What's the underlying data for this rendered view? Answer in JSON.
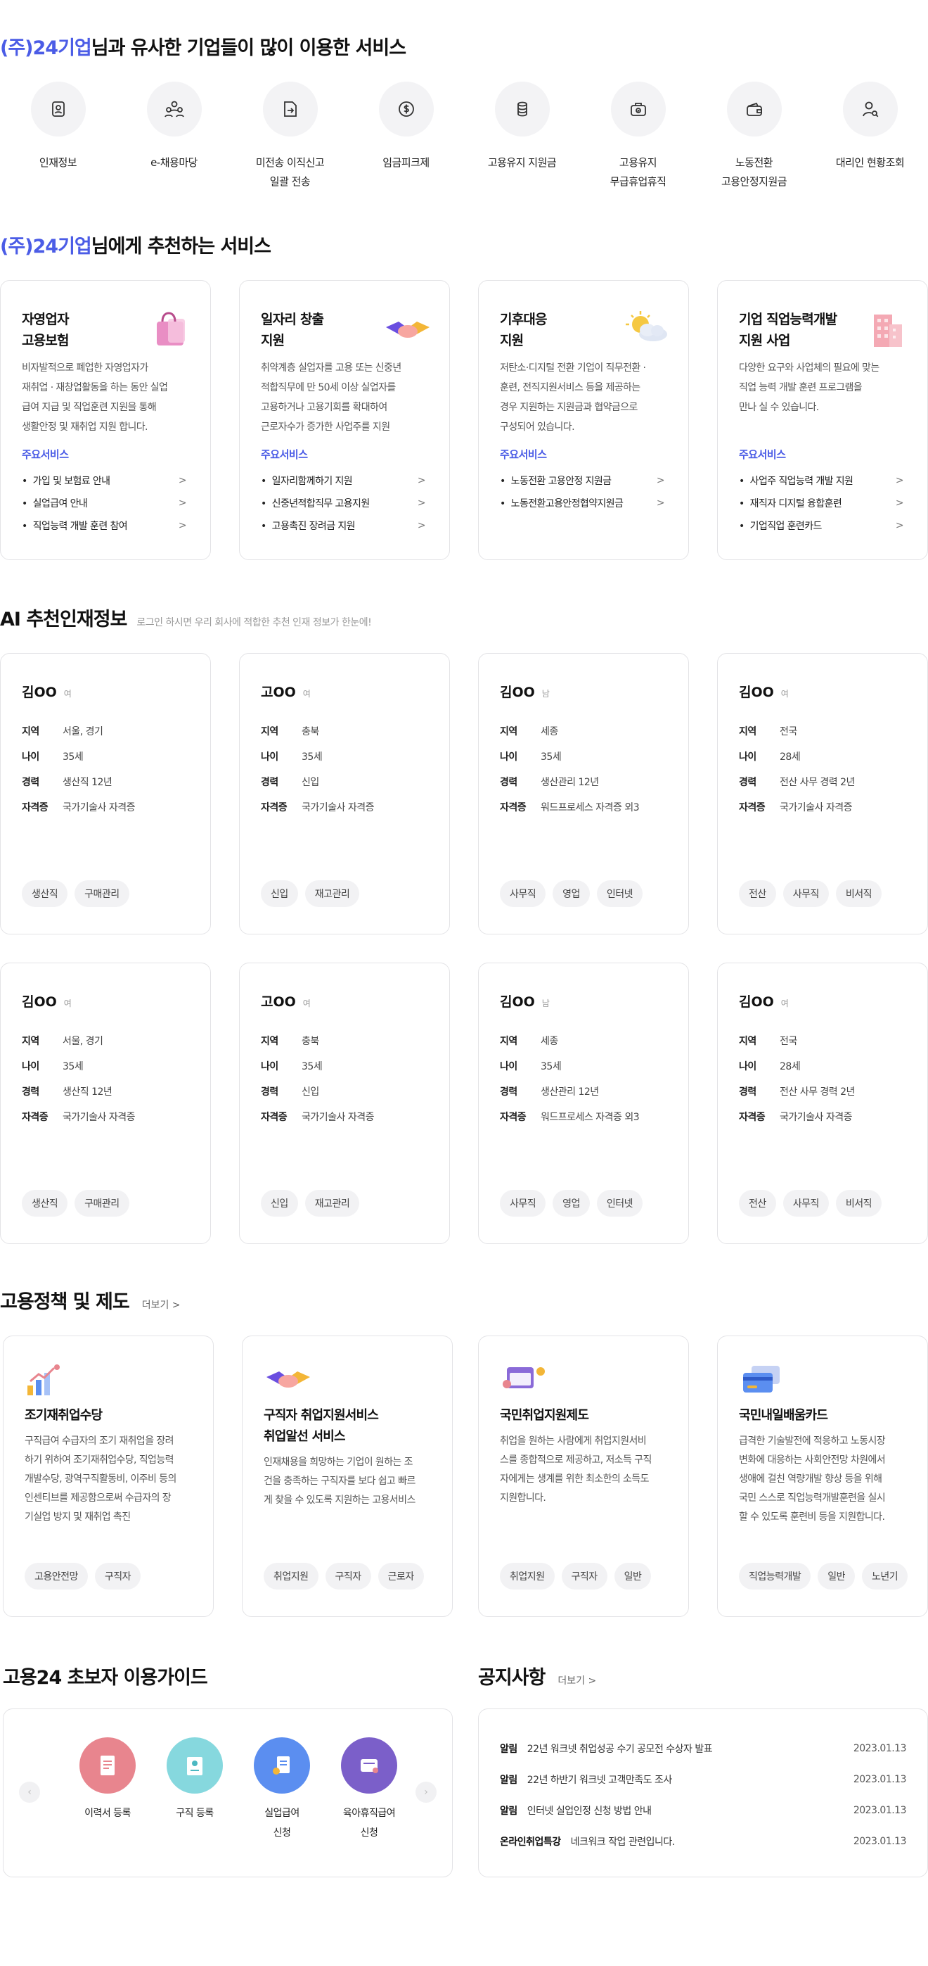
{
  "section1": {
    "company": "(주)24기업",
    "rest": "님과 유사한 기업들이 많이 이용한  서비스"
  },
  "services": [
    {
      "icon": "id-badge-icon",
      "line1": "인재정보",
      "line2": ""
    },
    {
      "icon": "people-icon",
      "line1": "e-채용마당",
      "line2": ""
    },
    {
      "icon": "document-send-icon",
      "line1": "미전송 이직신고",
      "line2": "일괄 전송"
    },
    {
      "icon": "dollar-circle-icon",
      "line1": "임금피크제",
      "line2": ""
    },
    {
      "icon": "coin-stack-icon",
      "line1": "고용유지 지원금",
      "line2": ""
    },
    {
      "icon": "briefcase-icon",
      "line1": "고용유지",
      "line2": "무급휴업휴직"
    },
    {
      "icon": "wallet-icon",
      "line1": "노동전환",
      "line2": "고용안정지원금"
    },
    {
      "icon": "user-search-icon",
      "line1": "대리인 현황조회",
      "line2": ""
    }
  ],
  "section2": {
    "company": "(주)24기업",
    "rest": "님에게 추천하는 서비스"
  },
  "main_services_label": "주요서비스",
  "recommend": [
    {
      "title1": "자영업자",
      "title2": "고용보험",
      "art": "shopping-bag-icon",
      "desc": [
        "비자발적으로 폐업한 자영업자가",
        "재취업 · 재창업활동을 하는 동안 실업",
        "급여 지급 및 직업훈련 지원을 통해",
        "생활안정 및 재취업 지원 합니다."
      ],
      "items": [
        "가입 및 보험료 안내",
        "실업급여 안내",
        "직업능력 개발 훈련 참여"
      ]
    },
    {
      "title1": "일자리 창출",
      "title2": "지원",
      "art": "handshake-icon",
      "desc": [
        "취약계층 실업자를 고용 또는 신중년",
        "적합직무에 만 50세 이상 실업자를",
        "고용하거나 고용기회를 확대하여",
        "근로자수가 증가한 사업주를 지원"
      ],
      "items": [
        "일자리함께하기 지원",
        "신중년적합직무 고용지원",
        "고용촉진 장려금 지원"
      ]
    },
    {
      "title1": "기후대응",
      "title2": "지원",
      "art": "sun-cloud-icon",
      "desc": [
        "저탄소·디지털 전환 기업이 직무전환 ·",
        "훈련, 전직지원서비스 등을 제공하는",
        "경우 지원하는 지원금과 협약금으로",
        "구성되어 있습니다."
      ],
      "items": [
        "노동전환 고용안정 지원금",
        "노동전환고용안정협약지원금"
      ]
    },
    {
      "title1": "기업 직업능력개발",
      "title2": "지원 사업",
      "art": "building-icon",
      "desc": [
        "다양한 요구와 사업체의 필요에 맞는",
        "직업 능력 개발 훈련 프로그램을",
        "만나 실 수 있습니다."
      ],
      "items": [
        "사업주 직업능력 개발 지원",
        "재직자 디지털 융합훈련",
        "기업직업 훈련카드"
      ]
    }
  ],
  "ai": {
    "title": "AI 추천인재정보",
    "subtitle": "로그인 하시면 우리 회사에 적합한 추천 인재 정보가 한눈에!"
  },
  "talent_keys": {
    "region": "지역",
    "age": "나이",
    "career": "경력",
    "cert": "자격증"
  },
  "talents": [
    {
      "name": "김OO",
      "gender": "여",
      "region": "서울, 경기",
      "age": "35세",
      "career": "생산직 12년",
      "cert": "국가기술사 자격증",
      "tags": [
        "생산직",
        "구매관리"
      ]
    },
    {
      "name": "고OO",
      "gender": "여",
      "region": "충북",
      "age": "35세",
      "career": "신입",
      "cert": "국가기술사 자격증",
      "tags": [
        "신입",
        "재고관리"
      ]
    },
    {
      "name": "김OO",
      "gender": "남",
      "region": "세종",
      "age": "35세",
      "career": "생산관리 12년",
      "cert": "워드프로세스 자격증 외3",
      "tags": [
        "사무직",
        "영업",
        "인터넷"
      ]
    },
    {
      "name": "김OO",
      "gender": "여",
      "region": "전국",
      "age": "28세",
      "career": "전산 사무 경력 2년",
      "cert": "국가기술사 자격증",
      "tags": [
        "전산",
        "사무직",
        "비서직"
      ]
    },
    {
      "name": "김OO",
      "gender": "여",
      "region": "서울, 경기",
      "age": "35세",
      "career": "생산직 12년",
      "cert": "국가기술사 자격증",
      "tags": [
        "생산직",
        "구매관리"
      ]
    },
    {
      "name": "고OO",
      "gender": "여",
      "region": "충북",
      "age": "35세",
      "career": "신입",
      "cert": "국가기술사 자격증",
      "tags": [
        "신입",
        "재고관리"
      ]
    },
    {
      "name": "김OO",
      "gender": "남",
      "region": "세종",
      "age": "35세",
      "career": "생산관리 12년",
      "cert": "워드프로세스 자격증 외3",
      "tags": [
        "사무직",
        "영업",
        "인터넷"
      ]
    },
    {
      "name": "김OO",
      "gender": "여",
      "region": "전국",
      "age": "28세",
      "career": "전산 사무 경력 2년",
      "cert": "국가기술사 자격증",
      "tags": [
        "전산",
        "사무직",
        "비서직"
      ]
    }
  ],
  "policy": {
    "title": "고용정책 및 제도",
    "more": "더보기 >"
  },
  "policies": [
    {
      "title1": "조기재취업수당",
      "title2": "",
      "art": "growth-chart-icon",
      "desc": [
        "구직급여 수급자의 조기 재취업을 장려",
        "하기 위하여 조기재취업수당, 직업능력",
        "개발수당, 광역구직활동비, 이주비 등의",
        "인센티브를 제공함으로써 수급자의 장",
        "기실업 방지 및 재취업 촉진"
      ],
      "tags": [
        "고용안전망",
        "구직자"
      ]
    },
    {
      "title1": "구직자 취업지원서비스",
      "title2": "취업알선 서비스",
      "art": "handshake-icon",
      "desc": [
        "인재채용을 희망하는 기업이 원하는 조",
        "건을 충족하는 구직자를 보다 쉽고 빠르",
        "게 찾을 수 있도록 지원하는 고용서비스"
      ],
      "tags": [
        "취업지원",
        "구직자",
        "근로자"
      ]
    },
    {
      "title1": "국민취업지원제도",
      "title2": "",
      "art": "window-icon",
      "desc": [
        "취업을 원하는 사람에게 취업지원서비",
        "스를 종합적으로 제공하고, 저소득 구직",
        "자에게는 생계를 위한 최소한의 소득도",
        "지원합니다."
      ],
      "tags": [
        "취업지원",
        "구직자",
        "일반"
      ]
    },
    {
      "title1": "국민내일배움카드",
      "title2": "",
      "art": "credit-card-icon",
      "desc": [
        "급격한 기술발전에 적응하고 노동시장",
        "변화에 대응하는 사회안전망 차원에서",
        "생애에 걸친 역량개발 향상 등을 위해",
        "국민 스스로 직업능력개발훈련을 실시",
        "할 수 있도록 훈련비 등을 지원합니다."
      ],
      "tags": [
        "직업능력개발",
        "일반",
        "노년기"
      ]
    }
  ],
  "guide": {
    "title": "고용24 초보자 이용가이드",
    "prev": "‹",
    "next": "›",
    "items": [
      {
        "line1": "이력서 등록",
        "line2": "",
        "icon": "resume-icon",
        "color": "#e8858e"
      },
      {
        "line1": "구직 등록",
        "line2": "",
        "icon": "job-register-icon",
        "color": "#86d8de"
      },
      {
        "line1": "실업급여",
        "line2": "신청",
        "icon": "benefit-icon",
        "color": "#5b8ef0"
      },
      {
        "line1": "육아휴직급여",
        "line2": "신청",
        "icon": "childcare-icon",
        "color": "#7b5fc9"
      }
    ]
  },
  "notice": {
    "title": "공지사항",
    "more": "더보기 >",
    "items": [
      {
        "cat": "알림",
        "text": "22년 워크넷 취업성공 수기 공모전 수상자 발표",
        "date": "2023.01.13"
      },
      {
        "cat": "알림",
        "text": "22년 하반기 워크넷 고객만족도 조사",
        "date": "2023.01.13"
      },
      {
        "cat": "알림",
        "text": "인터넷 실업인정 신청 방법 안내",
        "date": "2023.01.13"
      },
      {
        "cat": "온라인취업특강",
        "text": "네크워크 작업 관련입니다.",
        "date": "2023.01.13"
      }
    ]
  },
  "colors": {
    "accent": "#4b5ce6",
    "border": "#e3e3e6",
    "tag_bg": "#f2f2f4"
  }
}
